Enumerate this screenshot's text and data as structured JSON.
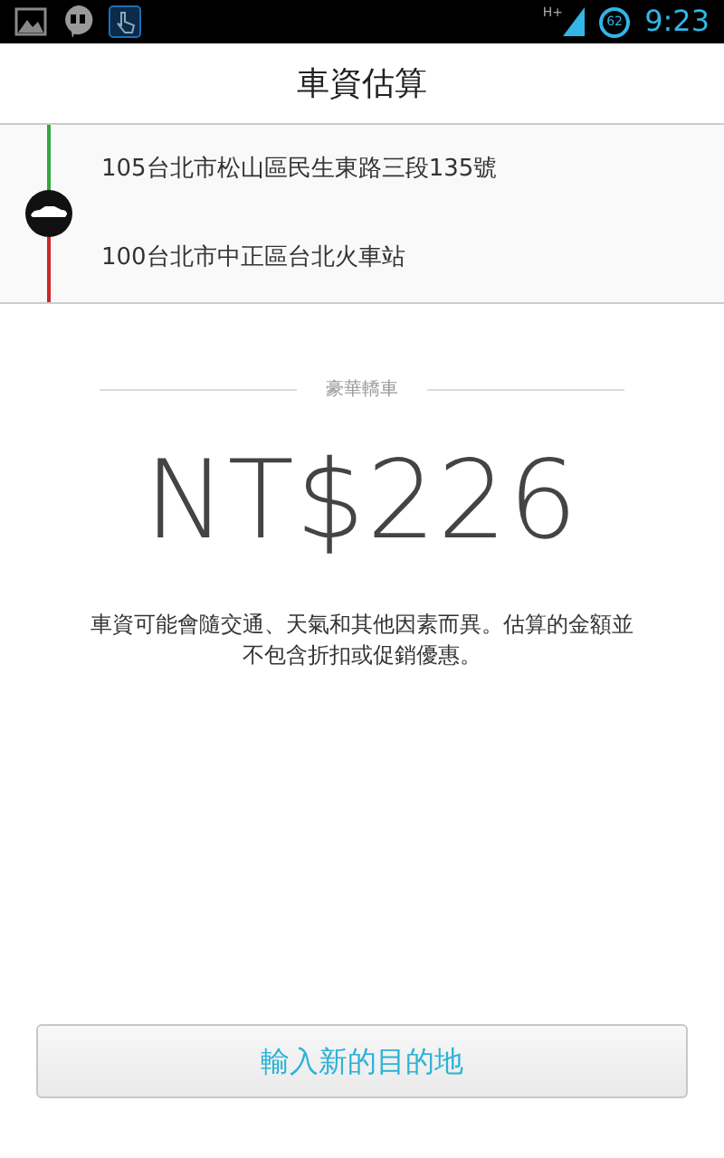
{
  "status_bar": {
    "network": "H+",
    "battery": "62",
    "time": "9:23"
  },
  "title": "車資估算",
  "route": [
    {
      "kind": "pickup",
      "address": "105台北市松山區民生東路三段135號",
      "color": "#2eaa3c"
    },
    {
      "kind": "dropoff",
      "address": "100台北市中正區台北火車站",
      "color": "#d0262a"
    }
  ],
  "vehicle": "豪華轎車",
  "fare": "NT$226",
  "disclaimer": "車資可能會隨交通、天氣和其他因素而異。估算的金額並不包含折扣或促銷優惠。",
  "button": "輸入新的目的地"
}
